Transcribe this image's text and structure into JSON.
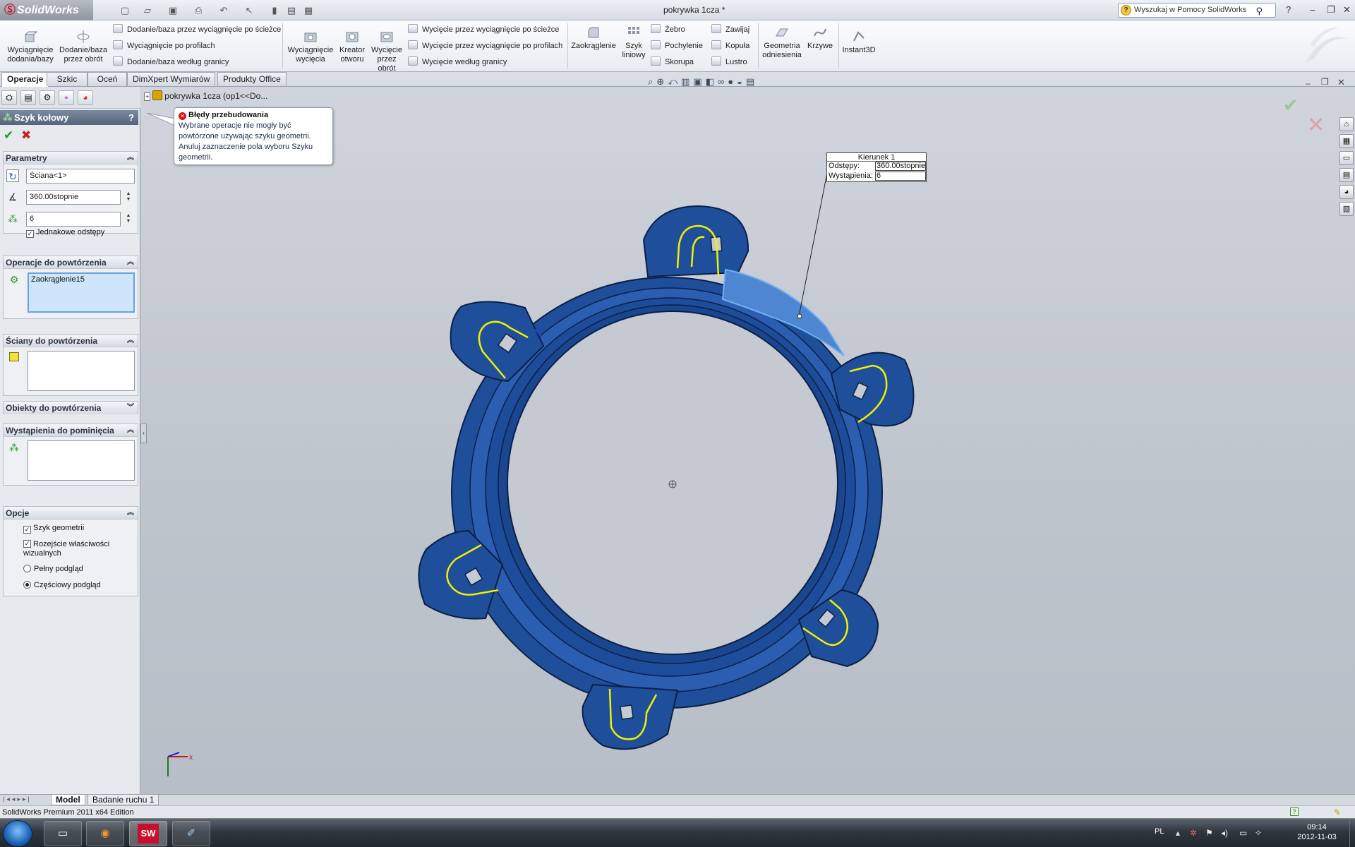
{
  "app": {
    "logo": "SolidWorks",
    "doc_title": "pokrywka 1cza *",
    "help_search": "Wyszukaj w Pomocy SolidWorks",
    "help_menu": "?"
  },
  "ribbon": {
    "extrude_boss": "Wyciągnięcie dodania/bazy",
    "revolve_boss": "Dodanie/baza przez obrót",
    "sweep_boss": "Dodanie/baza przez wyciągnięcie po ścieżce",
    "loft_boss": "Wyciągnięcie po profilach",
    "boundary_boss": "Dodanie/baza według granicy",
    "extrude_cut": "Wyciągnięcie wycięcia",
    "hole_wizard": "Kreator otworu",
    "revolve_cut": "Wycięcie przez obrót",
    "sweep_cut": "Wycięcie przez wyciągnięcie po ścieżce",
    "loft_cut": "Wycięcie przez wyciągnięcie po profilach",
    "boundary_cut": "Wycięcie według granicy",
    "fillet": "Zaokrąglenie",
    "linear_pattern": "Szyk liniowy",
    "rib": "Żebro",
    "draft": "Pochylenie",
    "shell": "Skorupa",
    "wrap": "Zawijaj",
    "dome": "Kopuła",
    "mirror": "Lustro",
    "ref_geometry": "Geometria odniesienia",
    "curves": "Krzywe",
    "instant3d": "Instant3D"
  },
  "tabs": [
    "Operacje",
    "Szkic",
    "Oceń",
    "DimXpert Wymiarów",
    "Produkty Office"
  ],
  "tree": {
    "root": "pokrywka 1cza  (op1<<Do..."
  },
  "pm": {
    "title": "Szyk kołowy",
    "help": "?",
    "params": {
      "title": "Parametry",
      "axis": "Ściana<1>",
      "angle": "360.00stopnie",
      "instances": "6",
      "equal_spacing": "Jednakowe odstępy"
    },
    "features": {
      "title": "Operacje do powtórzenia",
      "items": [
        "Zaokrąglenie15"
      ]
    },
    "faces": {
      "title": "Ściany do powtórzenia"
    },
    "bodies": {
      "title": "Obiekty do powtórzenia"
    },
    "skip": {
      "title": "Wystąpienia do pominięcia"
    },
    "options": {
      "title": "Opcje",
      "geometry_pattern": "Szyk geometrii",
      "propagate": "Rozejście właściwości wizualnych",
      "full_preview": "Pełny podgląd",
      "partial_preview": "Częściowy podgląd"
    }
  },
  "callout": {
    "title": "Błędy przebudowania",
    "text": "Wybrane operacje nie mogły być powtórzone używając szyku geometrii. Anuluj zaznaczenie pola wyboru Szyku geometrii."
  },
  "direction": {
    "title": "Kierunek 1",
    "spacing_label": "Odstępy:",
    "spacing_value": "360.00stopnie",
    "instances_label": "Wystąpienia:",
    "instances_value": "6"
  },
  "bottom_tabs": [
    "Model",
    "Badanie ruchu 1"
  ],
  "status": "SolidWorks Premium 2011 x64 Edition",
  "taskbar": {
    "lang": "PL",
    "time": "09:14",
    "date": "2012-11-03",
    "sw_label": "SW"
  },
  "colors": {
    "part_blue": "#1f4f9b",
    "edge_dark": "#0b1f47",
    "highlight_yellow": "#f0f000",
    "selection_blue": "#6fb0f0"
  }
}
